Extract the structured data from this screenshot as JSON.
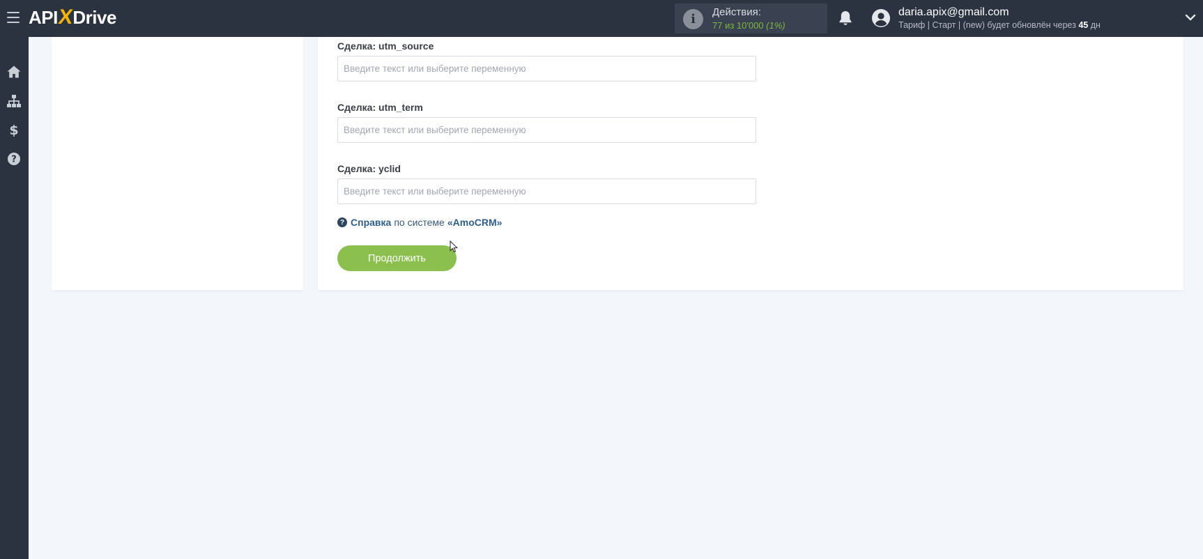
{
  "header": {
    "logo_left": "API",
    "logo_x": "X",
    "logo_right": "Drive",
    "actions_title": "Действия:",
    "actions_count": "77 из 10'000",
    "actions_percent": "(1%)",
    "user_email": "daria.apix@gmail.com",
    "plan_text": "Тариф | Старт | (new) будет обновлён через",
    "plan_days": "45",
    "plan_days_unit": "дн"
  },
  "sidebar": {
    "items": [
      "home-icon",
      "sitemap-icon",
      "dollar-icon",
      "help-icon"
    ]
  },
  "form": {
    "fields": [
      {
        "label": "Сделка: utm_source",
        "placeholder": "Введите текст или выберите переменную"
      },
      {
        "label": "Сделка: utm_term",
        "placeholder": "Введите текст или выберите переменную"
      },
      {
        "label": "Сделка: yclid",
        "placeholder": "Введите текст или выберите переменную"
      }
    ],
    "help_link": "Справка",
    "help_middle": "по системе",
    "help_system": "«AmoCRM»",
    "continue_label": "Продолжить"
  },
  "colors": {
    "topbar": "#2c3340",
    "accent_green": "#8bbf4e",
    "logo_x": "#f5b400",
    "background": "#f3f6fb"
  }
}
